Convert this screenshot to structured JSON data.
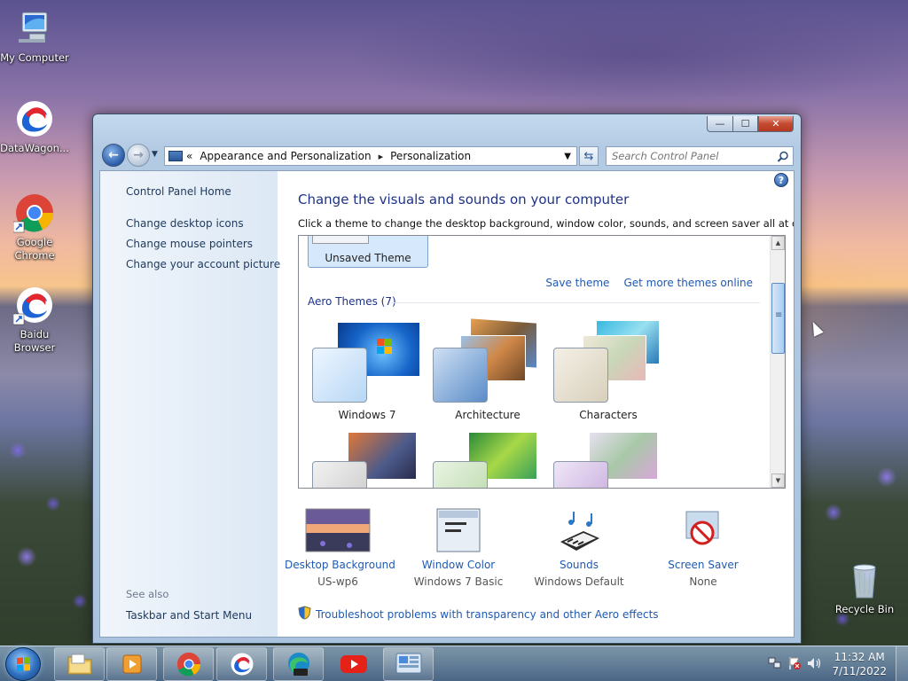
{
  "desktop": {
    "icons": [
      {
        "label": "My Computer"
      },
      {
        "label": "DataWagon..."
      },
      {
        "label": "Google Chrome"
      },
      {
        "label": "Baidu Browser"
      },
      {
        "label": "Recycle Bin"
      }
    ]
  },
  "window": {
    "controls": {
      "minimize": "—",
      "maximize": "☐",
      "close": "✕"
    },
    "address": {
      "overflow": "«",
      "segments": [
        "Appearance and Personalization",
        "Personalization"
      ],
      "separator": "▸",
      "dropdown": "▼"
    },
    "refresh_glyph": "⇆",
    "search": {
      "placeholder": "Search Control Panel"
    }
  },
  "leftpane": {
    "home": "Control Panel Home",
    "links": [
      "Change desktop icons",
      "Change mouse pointers",
      "Change your account picture"
    ],
    "see_also_heading": "See also",
    "see_also": [
      "Taskbar and Start Menu"
    ]
  },
  "main": {
    "help": "?",
    "heading": "Change the visuals and sounds on your computer",
    "subheading": "Click a theme to change the desktop background, window color, sounds, and screen saver all at once.",
    "unsaved_theme": "Unsaved Theme",
    "save_theme": "Save theme",
    "get_more": "Get more themes online",
    "aero_group": "Aero Themes (7)",
    "themes": [
      {
        "name": "Windows 7"
      },
      {
        "name": "Architecture"
      },
      {
        "name": "Characters"
      },
      {
        "name": ""
      },
      {
        "name": ""
      },
      {
        "name": ""
      }
    ],
    "bottom": [
      {
        "link": "Desktop Background",
        "value": "US-wp6"
      },
      {
        "link": "Window Color",
        "value": "Windows 7 Basic"
      },
      {
        "link": "Sounds",
        "value": "Windows Default"
      },
      {
        "link": "Screen Saver",
        "value": "None"
      }
    ],
    "troubleshoot": "Troubleshoot problems with transparency and other Aero effects"
  },
  "taskbar": {
    "pinned": [
      "file-explorer",
      "media-player",
      "google-chrome",
      "baidu-browser",
      "edge-dev",
      "youtube",
      "control-panel"
    ],
    "clock": {
      "time": "11:32 AM",
      "date": "7/11/2022"
    },
    "tray": [
      "network-icon",
      "action-center-flag-icon",
      "volume-icon"
    ]
  },
  "colors": {
    "link": "#1e5ab4",
    "heading": "#1e3287",
    "accent": "#2e6fbe"
  }
}
